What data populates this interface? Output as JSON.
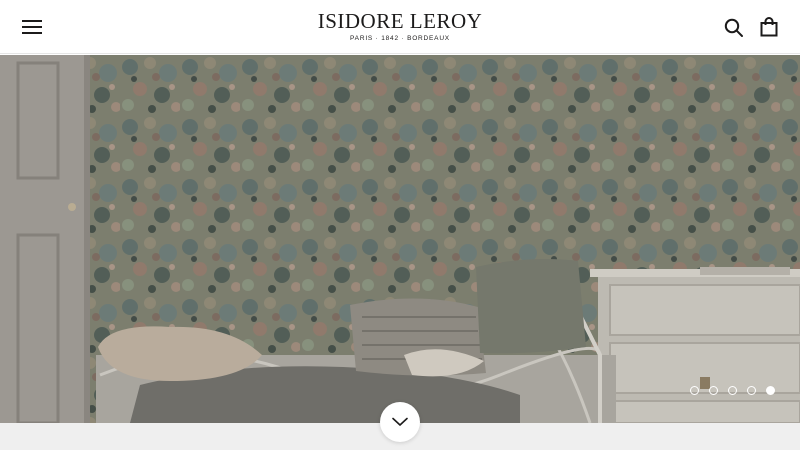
{
  "header": {
    "brand_name": "ISIDORE LEROY",
    "brand_tagline": "PARIS · 1842 · BORDEAUX",
    "menu_icon": "hamburger-menu-icon",
    "search_icon": "search-icon",
    "cart_icon": "shopping-bag-icon"
  },
  "hero": {
    "image_subject": "floral wallpaper bedroom with daybed and dresser",
    "slides_total": 5,
    "active_slide": 5,
    "scroll_icon": "chevron-down-icon"
  },
  "colors": {
    "text": "#1c1b1b",
    "header_bg": "#ffffff",
    "footer_strip": "#efefef"
  }
}
